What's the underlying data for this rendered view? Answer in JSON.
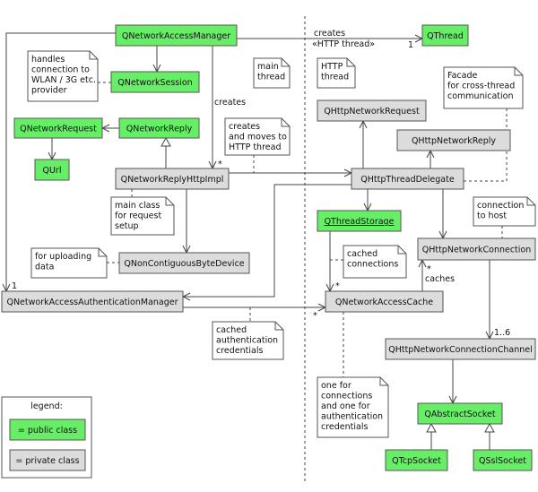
{
  "colors": {
    "public_class": "#66ee66",
    "private_class": "#dcdcdc",
    "border": "#555555"
  },
  "classes": [
    {
      "name": "QNetworkAccessManager",
      "visibility": "public"
    },
    {
      "name": "QNetworkSession",
      "visibility": "public"
    },
    {
      "name": "QNetworkRequest",
      "visibility": "public"
    },
    {
      "name": "QNetworkReply",
      "visibility": "public"
    },
    {
      "name": "QUrl",
      "visibility": "public"
    },
    {
      "name": "QNetworkReplyHttpImpl",
      "visibility": "private"
    },
    {
      "name": "QNonContiguousByteDevice",
      "visibility": "private"
    },
    {
      "name": "QNetworkAccessAuthenticationManager",
      "visibility": "private"
    },
    {
      "name": "QThread",
      "visibility": "public"
    },
    {
      "name": "QHttpNetworkRequest",
      "visibility": "private"
    },
    {
      "name": "QHttpNetworkReply",
      "visibility": "private"
    },
    {
      "name": "QHttpThreadDelegate",
      "visibility": "private"
    },
    {
      "name": "QThreadStorage",
      "visibility": "public",
      "underlined": true
    },
    {
      "name": "QHttpNetworkConnection",
      "visibility": "private"
    },
    {
      "name": "QNetworkAccessCache",
      "visibility": "private"
    },
    {
      "name": "QHttpNetworkConnectionChannel",
      "visibility": "private"
    },
    {
      "name": "QAbstractSocket",
      "visibility": "public"
    },
    {
      "name": "QTcpSocket",
      "visibility": "public"
    },
    {
      "name": "QSslSocket",
      "visibility": "public"
    }
  ],
  "notes": [
    {
      "lines": [
        "handles",
        "connection to",
        "WLAN / 3G etc.",
        "provider"
      ]
    },
    {
      "lines": [
        "main",
        "thread"
      ]
    },
    {
      "lines": [
        "creates",
        "and moves to",
        "HTTP thread"
      ]
    },
    {
      "lines": [
        "main class",
        "for request",
        "setup"
      ]
    },
    {
      "lines": [
        "for uploading",
        "data"
      ]
    },
    {
      "lines": [
        "cached",
        "authentication",
        "credentials"
      ]
    },
    {
      "lines": [
        "HTTP",
        "thread"
      ]
    },
    {
      "lines": [
        "Facade",
        "for cross-thread",
        "communication"
      ]
    },
    {
      "lines": [
        "connection",
        "to host"
      ]
    },
    {
      "lines": [
        "cached",
        "connections"
      ]
    },
    {
      "lines": [
        "one for",
        "connections",
        "and one for",
        "authentication",
        "credentials"
      ]
    }
  ],
  "labels": {
    "creates": "creates",
    "creates_thread": "creates",
    "http_thread_stereotype": "«HTTP thread»",
    "mult_thread_1": "1",
    "mult_reply_star": "*",
    "mult_auth_1": "1",
    "mult_cache_star": "*",
    "mult_storage_star": "*",
    "mult_conn_star": "*",
    "caches": "caches",
    "mult_channel": "1..6"
  },
  "legend": {
    "title": "legend:",
    "public_label": "= public class",
    "private_label": "= private class"
  }
}
